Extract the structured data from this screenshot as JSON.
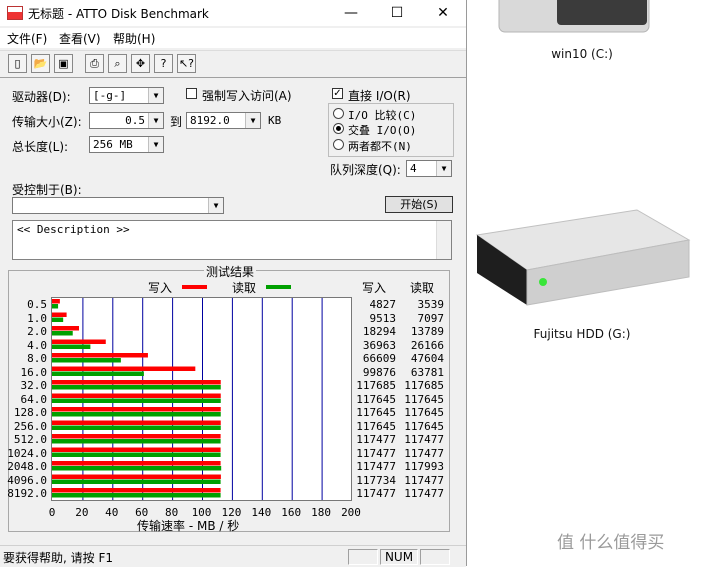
{
  "window": {
    "title": "无标题 - ATTO Disk Benchmark",
    "minimize": "—",
    "maximize": "☐",
    "close": "✕"
  },
  "menu": [
    "文件(F)",
    "查看(V)",
    "帮助(H)"
  ],
  "toolbar": [
    "new-icon",
    "open-icon",
    "save-icon",
    "print-icon",
    "preview-icon",
    "move-icon",
    "help-icon",
    "whats-this-icon"
  ],
  "form": {
    "drive_label": "驱动器(D):",
    "drive_value": "[-g-]",
    "force_write_label": "强制写入访问(A)",
    "direct_io_label": "直接 I/O(R)",
    "direct_io_checked": true,
    "transfer_label": "传输大小(Z):",
    "transfer_from": "0.5",
    "to_label": "到",
    "transfer_to": "8192.0",
    "kb_label": "KB",
    "total_label": "总长度(L):",
    "total_value": "256 MB",
    "io_compare": "I/O 比较(C)",
    "overlapped_io": "交叠 I/O(O)",
    "neither": "两者都不(N)",
    "queue_label": "队列深度(Q):",
    "queue_value": "4",
    "controlled_by_label": "受控制于(B):",
    "controlled_by_value": "",
    "start_button": "开始(S)",
    "description": "<< Description >>"
  },
  "results": {
    "title": "测试结果",
    "legend_write": "写入",
    "legend_read": "读取",
    "col_write": "写入",
    "col_read": "读取",
    "xlabel": "传输速率 - MB / 秒",
    "rows": [
      [
        "0.5",
        "4827",
        "3539"
      ],
      [
        "1.0",
        "9513",
        "7097"
      ],
      [
        "2.0",
        "18294",
        "13789"
      ],
      [
        "4.0",
        "36963",
        "26166"
      ],
      [
        "8.0",
        "66609",
        "47604"
      ],
      [
        "16.0",
        "99876",
        "63781"
      ],
      [
        "32.0",
        "117685",
        "117685"
      ],
      [
        "64.0",
        "117645",
        "117645"
      ],
      [
        "128.0",
        "117645",
        "117645"
      ],
      [
        "256.0",
        "117645",
        "117645"
      ],
      [
        "512.0",
        "117477",
        "117477"
      ],
      [
        "1024.0",
        "117477",
        "117477"
      ],
      [
        "2048.0",
        "117477",
        "117993"
      ],
      [
        "4096.0",
        "117734",
        "117477"
      ],
      [
        "8192.0",
        "117477",
        "117477"
      ]
    ]
  },
  "chart_data": {
    "type": "bar",
    "categories": [
      "0.5",
      "1.0",
      "2.0",
      "4.0",
      "8.0",
      "16.0",
      "32.0",
      "64.0",
      "128.0",
      "256.0",
      "512.0",
      "1024.0",
      "2048.0",
      "4096.0",
      "8192.0"
    ],
    "series": [
      {
        "name": "写入",
        "color": "#ff0000",
        "values": [
          4.6,
          9.1,
          17.4,
          35.3,
          63.5,
          95.2,
          112.2,
          112.2,
          112.2,
          112.2,
          112.1,
          112.1,
          112.1,
          112.3,
          112.1
        ]
      },
      {
        "name": "读取",
        "color": "#00a000",
        "values": [
          3.4,
          6.8,
          13.2,
          25.0,
          45.4,
          60.8,
          112.2,
          112.2,
          112.2,
          112.2,
          112.1,
          112.1,
          112.5,
          112.1,
          112.1
        ]
      }
    ],
    "xticks": [
      "0",
      "20",
      "40",
      "60",
      "80",
      "100",
      "120",
      "140",
      "160",
      "180",
      "200"
    ],
    "xlim": [
      0,
      200
    ],
    "xlabel": "传输速率 - MB / 秒",
    "grid": true
  },
  "status": {
    "help_text": "要获得帮助, 请按 F1",
    "num": "NUM"
  },
  "desktop": {
    "drive1_label": "win10 (C:)",
    "drive2_label": "Fujitsu HDD (G:)",
    "watermark": "值 什么值得买"
  }
}
